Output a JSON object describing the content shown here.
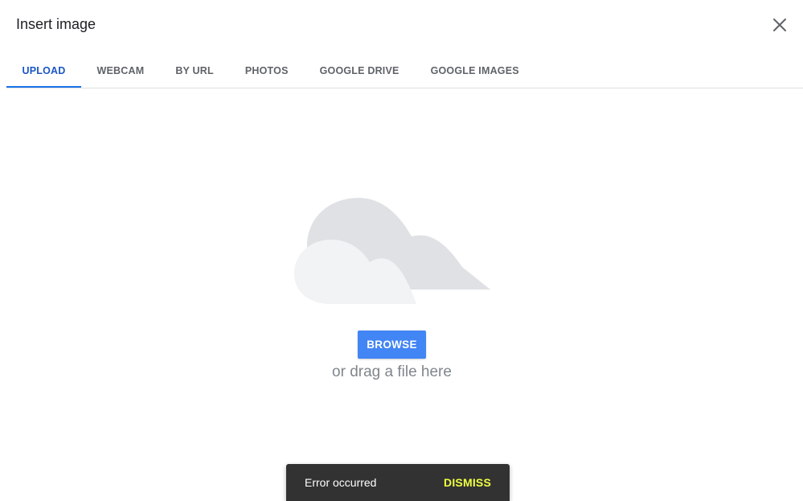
{
  "dialog": {
    "title": "Insert image",
    "close_icon": "close-icon"
  },
  "tabs": [
    {
      "label": "UPLOAD",
      "active": true
    },
    {
      "label": "WEBCAM",
      "active": false
    },
    {
      "label": "BY URL",
      "active": false
    },
    {
      "label": "PHOTOS",
      "active": false
    },
    {
      "label": "GOOGLE DRIVE",
      "active": false
    },
    {
      "label": "GOOGLE IMAGES",
      "active": false
    }
  ],
  "upload": {
    "illustration_icon": "cloud-icon",
    "browse_label": "BROWSE",
    "drag_hint": "or drag a file here"
  },
  "snackbar": {
    "message": "Error occurred",
    "action_label": "DISMISS"
  },
  "colors": {
    "accent": "#4285f4",
    "active_tab": "#1a56c4",
    "snackbar_bg": "#323232",
    "snackbar_action": "#eeff41"
  }
}
